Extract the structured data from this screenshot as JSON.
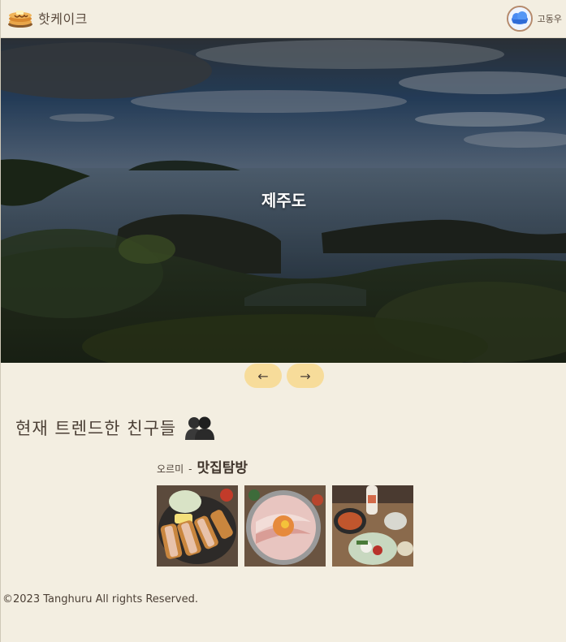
{
  "header": {
    "brand": "핫케이크",
    "logo_icon": "pancake-icon",
    "user_name": "고동우",
    "avatar_icon": "cloud-avatar-icon"
  },
  "hero": {
    "caption": "제주도",
    "prev_label": "←",
    "next_label": "→"
  },
  "trending": {
    "heading": "현재 트렌드한 친구들",
    "heading_icon": "friends-icon",
    "post": {
      "author": "오르미",
      "separator": "-",
      "category": "맛집탐방",
      "thumbnails": [
        "tonkatsu-photo",
        "pork-belly-photo",
        "korean-dishes-photo"
      ]
    }
  },
  "footer": {
    "copyright": "©2023 Tanghuru All rights Reserved."
  },
  "colors": {
    "background": "#f3eee1",
    "button": "#f7dc9a",
    "text": "#4b3f35"
  }
}
